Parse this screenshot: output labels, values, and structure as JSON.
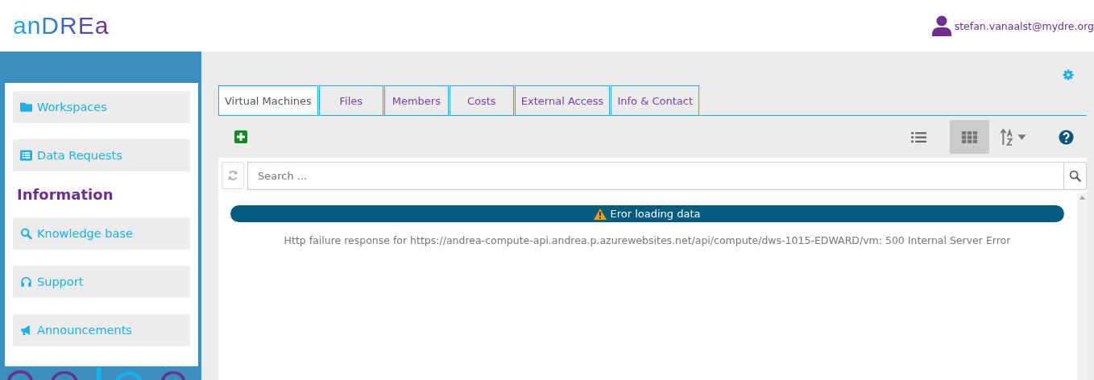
{
  "header": {
    "logo": "anDREa",
    "user": "stefan.vanaalst@mydre.org"
  },
  "sidebar": {
    "items": [
      {
        "kind": "folder",
        "label": "Workspaces"
      },
      {
        "kind": "list",
        "label": "Data Requests"
      },
      {
        "kind": "heading",
        "label": "Information"
      },
      {
        "kind": "search",
        "label": "Knowledge base"
      },
      {
        "kind": "headset",
        "label": "Support"
      },
      {
        "kind": "megaphone",
        "label": "Announcements"
      }
    ]
  },
  "tabs": [
    {
      "label": "Virtual Machines",
      "selected": true
    },
    {
      "label": "Files",
      "selected": false
    },
    {
      "label": "Members",
      "selected": false
    },
    {
      "label": "Costs",
      "selected": false
    },
    {
      "label": "External Access",
      "selected": false
    },
    {
      "label": "Info & Contact",
      "selected": false
    }
  ],
  "view_options": [
    {
      "kind": "list",
      "selected": false
    },
    {
      "kind": "grid",
      "selected": true
    }
  ],
  "search": {
    "placeholder": "Search ..."
  },
  "error": {
    "title": "Eror loading data",
    "message": "Http failure response for https://andrea-compute-api.andrea.p.azurewebsites.net/api/compute/dws-1015-EDWARD/vm: 500 Internal Server Error"
  }
}
